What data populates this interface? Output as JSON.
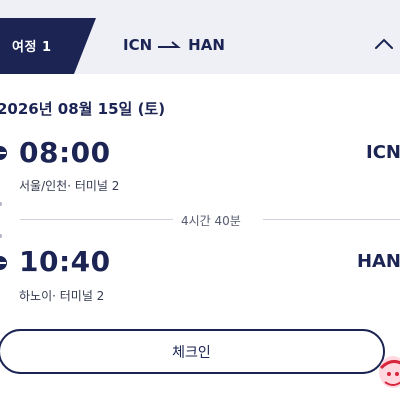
{
  "header": {
    "tab_label": "여정 1",
    "route": {
      "from": "ICN",
      "to": "HAN"
    }
  },
  "journey": {
    "date": "2026년 08월 15일 (토)",
    "departure": {
      "time": "08:00",
      "airport_code": "ICN",
      "terminal": "서울/인천· 터미널 2"
    },
    "duration": "4시간 40분",
    "arrival": {
      "time": "10:40",
      "airport_code": "HAN",
      "terminal": "하노이· 터미널 2"
    }
  },
  "actions": {
    "checkin_label": "체크인"
  },
  "colors": {
    "navy": "#1b2452",
    "header_bg": "#eef0f6",
    "tab_bg": "#1b2452",
    "badge_red": "#d7263d"
  },
  "icons": [
    "plane-arrow-icon",
    "chevron-up-icon",
    "departure-dot-icon",
    "arrival-dot-icon",
    "floating-badge-icon"
  ]
}
